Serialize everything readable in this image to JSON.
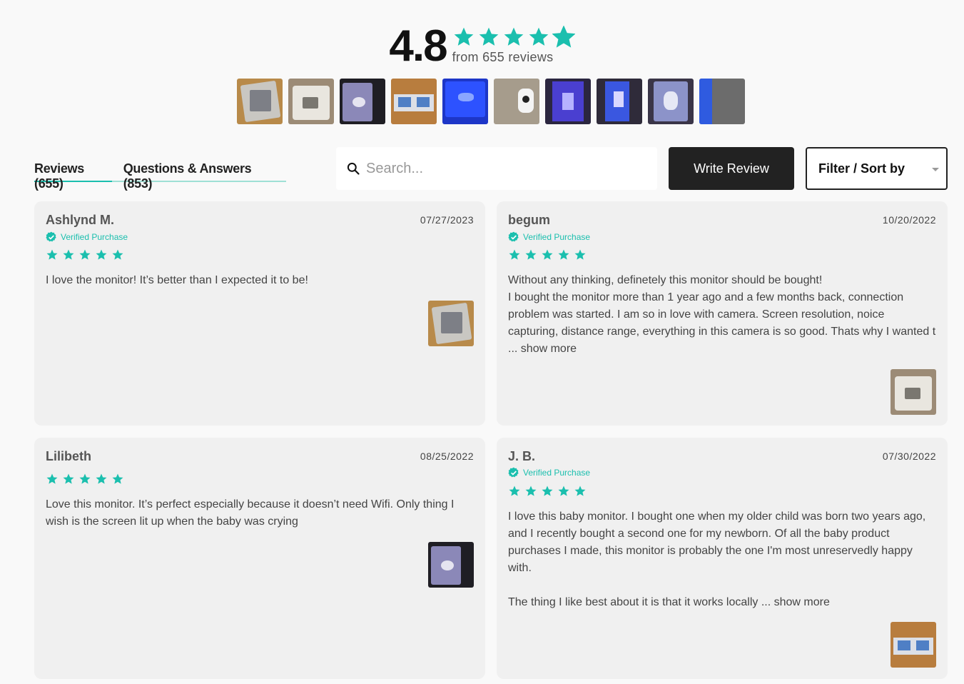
{
  "summary": {
    "average": "4.8",
    "rating": 4.8,
    "review_count_text": "from 655 reviews",
    "star_color": "#1bbfae"
  },
  "photos": [
    {
      "alt": "review-photo-1"
    },
    {
      "alt": "review-photo-2"
    },
    {
      "alt": "review-photo-3"
    },
    {
      "alt": "review-photo-4"
    },
    {
      "alt": "review-photo-5"
    },
    {
      "alt": "review-photo-6"
    },
    {
      "alt": "review-photo-7"
    },
    {
      "alt": "review-photo-8"
    },
    {
      "alt": "review-photo-9"
    },
    {
      "alt": "review-photo-10"
    }
  ],
  "tabs": [
    {
      "label": "Reviews (655)",
      "active": true
    },
    {
      "label": "Questions & Answers (853)",
      "active": false
    }
  ],
  "search": {
    "placeholder": "Search...",
    "icon": "search-icon"
  },
  "write_review_label": "Write Review",
  "filter": {
    "label": "Filter / Sort by",
    "icon": "chevron-down-icon"
  },
  "reviews": [
    {
      "name": "Ashlynd M.",
      "date": "07/27/2023",
      "verified": "Verified Purchase",
      "stars": 5,
      "body": [
        "I love the monitor! It’s better than I expected it to be!"
      ],
      "show_more": ""
    },
    {
      "name": "begum",
      "date": "10/20/2022",
      "verified": "Verified Purchase",
      "stars": 5,
      "body": [
        "Without any thinking, definetely this monitor should be bought!",
        "I bought the monitor more than 1 year ago and a few months back, connection problem was started. I am so in love with camera. Screen resolution, noice capturing, distance range, everything in this camera is so good. Thats why I wanted t ..."
      ],
      "show_more": "show more"
    },
    {
      "name": "Lilibeth",
      "date": "08/25/2022",
      "verified": "",
      "stars": 5,
      "body": [
        "Love this monitor. It’s perfect especially because it doesn’t need Wifi. Only thing I wish is the screen lit up when the baby was crying"
      ],
      "show_more": ""
    },
    {
      "name": "J. B.",
      "date": "07/30/2022",
      "verified": "Verified Purchase",
      "stars": 5,
      "body": [
        "I love this baby monitor. I bought one when my older child was born two years ago, and I recently bought a second one for my newborn. Of all the baby product purchases I made, this monitor is probably the one I'm most unreservedly happy with.",
        "The thing I like best about it is that it works locally  ..."
      ],
      "show_more": "show more"
    }
  ]
}
